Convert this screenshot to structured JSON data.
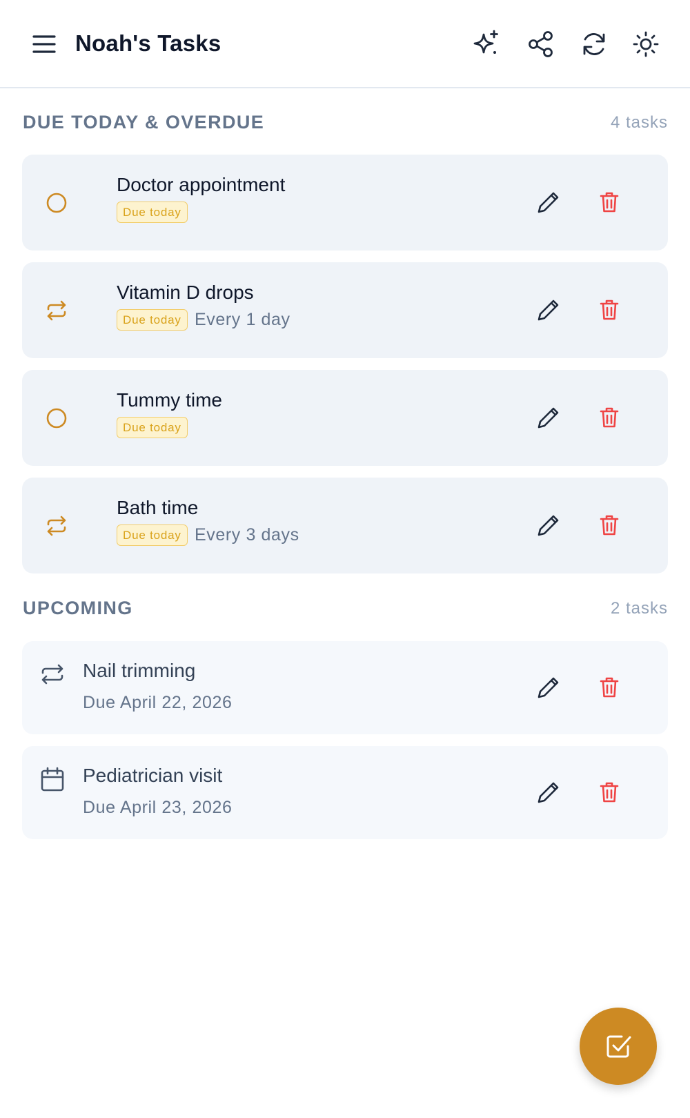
{
  "header": {
    "title": "Noah's Tasks",
    "icons": [
      "menu-icon",
      "sparkles-icon",
      "share-icon",
      "refresh-icon",
      "sun-icon"
    ]
  },
  "sections": [
    {
      "title": "DUE TODAY & OVERDUE",
      "count": "4 tasks",
      "tasks": [
        {
          "title": "Doctor appointment",
          "badge": "Due today",
          "recurrence": "",
          "icon": "circle-icon"
        },
        {
          "title": "Vitamin D drops",
          "badge": "Due today",
          "recurrence": "Every 1 day",
          "icon": "repeat-icon"
        },
        {
          "title": "Tummy time",
          "badge": "Due today",
          "recurrence": "",
          "icon": "circle-icon"
        },
        {
          "title": "Bath time",
          "badge": "Due today",
          "recurrence": "Every 3 days",
          "icon": "repeat-icon"
        }
      ]
    },
    {
      "title": "UPCOMING",
      "count": "2 tasks",
      "tasks": [
        {
          "title": "Nail trimming",
          "due": "Due April 22, 2026",
          "icon": "repeat-icon"
        },
        {
          "title": "Pediatrician visit",
          "due": "Due April 23, 2026",
          "icon": "calendar-icon"
        }
      ]
    }
  ],
  "colors": {
    "accent": "#cd8a23",
    "delete": "#ef4444",
    "badge_bg": "#fdf3cf",
    "badge_text": "#d9a21a",
    "card_bg": "#eff3f8"
  },
  "fab": {
    "icon": "check-square-icon"
  }
}
